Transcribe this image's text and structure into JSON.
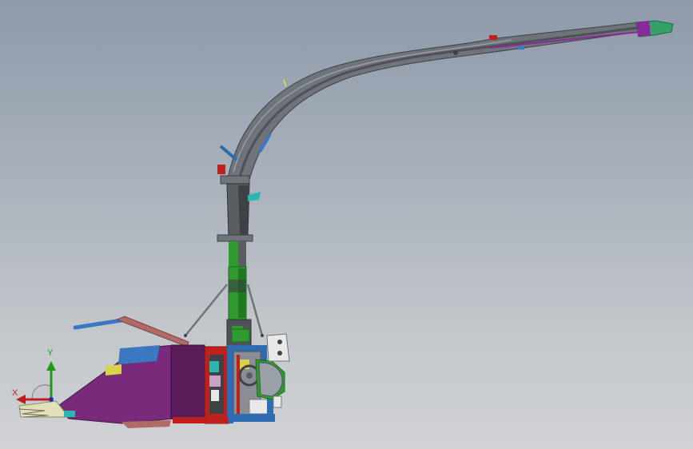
{
  "viewport": {
    "background_top": "#8e9aaa",
    "background_bottom": "#d0d2d4"
  },
  "model": {
    "description_visible": false,
    "part_colors": {
      "spout": "#6f737a",
      "spout_dark": "#4e5258",
      "spout_tip": "#35a06a",
      "tip_accent": "#8a2a9a",
      "column": "#5a5d62",
      "column_green": "#2f9a2f",
      "header_purple": "#7a2a7a",
      "header_dark": "#5a1d5a",
      "frame_blue": "#2e6bb0",
      "frame_red": "#c0201c",
      "cylinder_red": "#b06a68",
      "lever_blue": "#3a78c2",
      "yellow": "#d8d44a",
      "cyan": "#2cb6b0",
      "white": "#e8e8e8"
    }
  },
  "triad": {
    "y_label": "Y",
    "x_label": "X",
    "y_color": "#1f9a1f",
    "x_color": "#c21d1d",
    "z_color": "#2a2ab0"
  }
}
